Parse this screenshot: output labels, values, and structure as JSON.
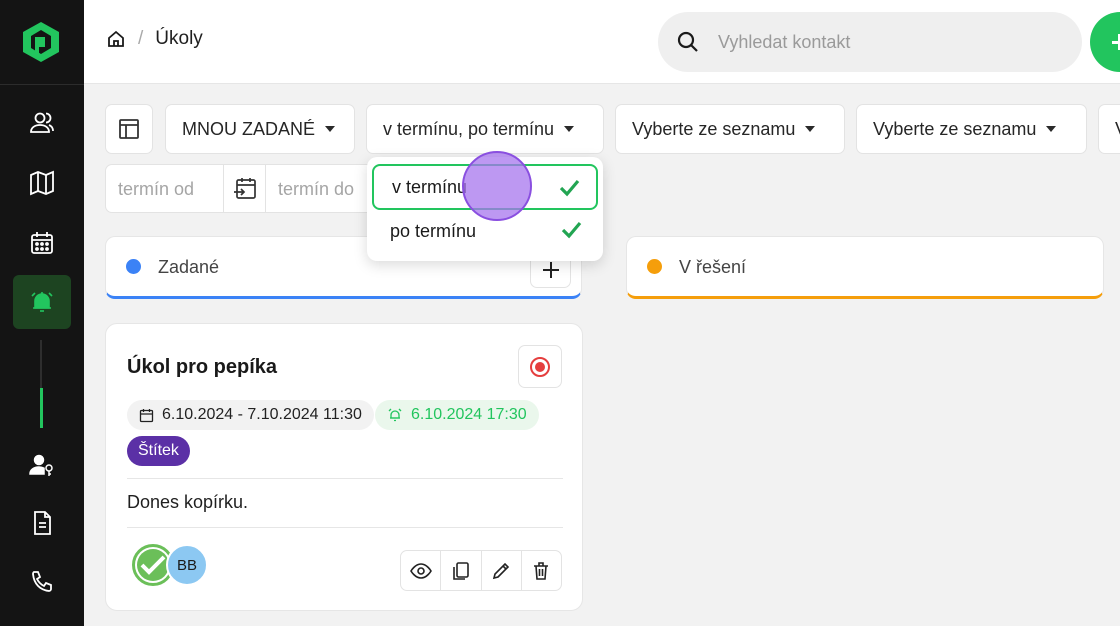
{
  "colors": {
    "accent": "#22c55e",
    "sidebar_bg": "#141414",
    "tag_purple": "#5b30a6",
    "col_blue": "#3b82f6",
    "col_orange": "#f59e0b"
  },
  "sidebar": {
    "items": [
      {
        "icon": "users-icon"
      },
      {
        "icon": "map-icon"
      },
      {
        "icon": "calendar-icon"
      },
      {
        "icon": "alarm-bell-icon",
        "active": true
      },
      {
        "icon": "user-key-icon"
      },
      {
        "icon": "document-icon"
      },
      {
        "icon": "phone-icon"
      }
    ]
  },
  "header": {
    "breadcrumb": {
      "current": "Úkoly"
    },
    "search": {
      "placeholder": "Vyhledat kontakt"
    }
  },
  "filters": {
    "assigned": "MNOU ZADANÉ",
    "deadline": "v termínu, po termínu",
    "list1": "Vyberte ze seznamu",
    "list2": "Vyberte ze seznamu",
    "list3": "V",
    "date_from_placeholder": "termín od",
    "date_to_placeholder": "termín do"
  },
  "deadline_dropdown": {
    "options": [
      {
        "label": "v termínu",
        "checked": true
      },
      {
        "label": "po termínu",
        "checked": true
      }
    ]
  },
  "columns": [
    {
      "title": "Zadané",
      "color": "#3b82f6"
    },
    {
      "title": "V řešení",
      "color": "#f59e0b"
    }
  ],
  "task_card": {
    "title": "Úkol pro pepíka",
    "date_range": "6.10.2024 - 7.10.2024 11:30",
    "reminder": "6.10.2024 17:30",
    "tag": "Štítek",
    "description": "Dones kopírku.",
    "avatars": [
      "BB"
    ]
  }
}
